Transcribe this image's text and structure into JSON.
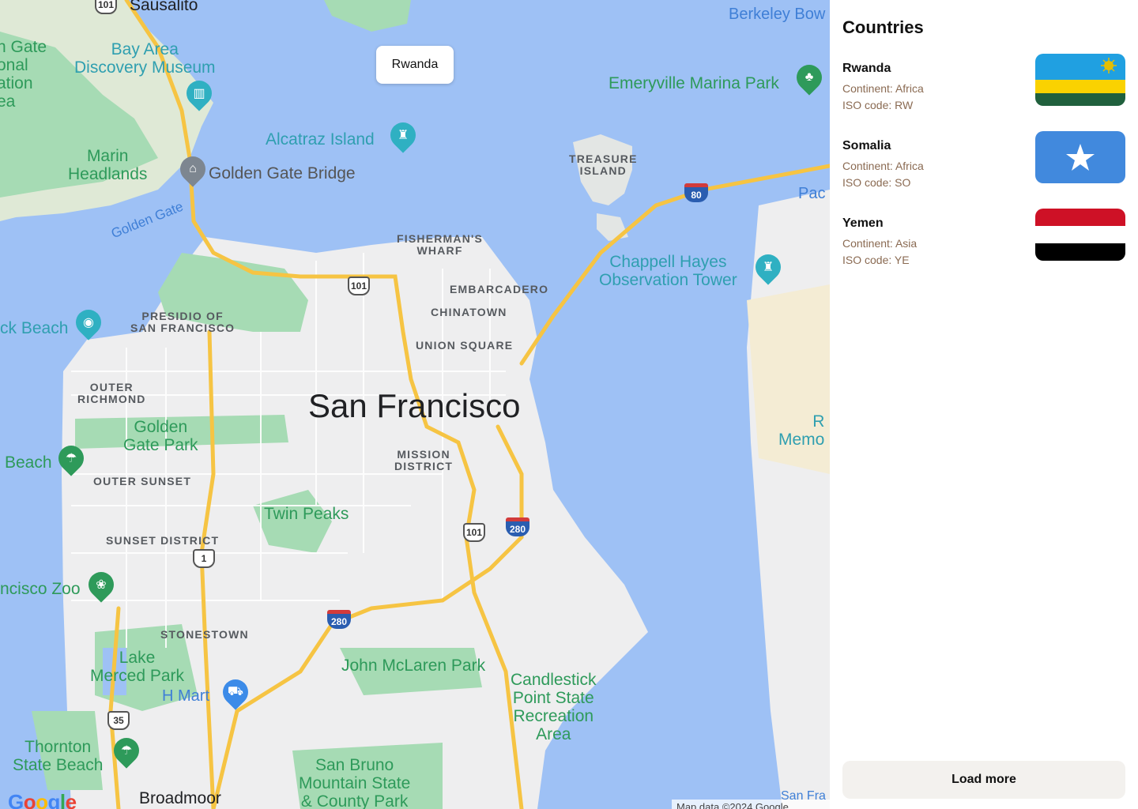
{
  "map": {
    "tooltip": "Rwanda",
    "labels": {
      "sausalito": "Sausalito",
      "berkeley": "Berkeley Bow",
      "golden_gate_nra": "n Gate\nonal\nation\nea",
      "bay_area_museum": "Bay Area\nDiscovery Museum",
      "emeryville": "Emeryville Marina Park",
      "alcatraz": "Alcatraz Island",
      "marin": "Marin\nHeadlands",
      "gg_bridge": "Golden Gate Bridge",
      "golden_gate_water": "Golden Gate",
      "treasure_island": "TREASURE\nISLAND",
      "pac": "Pac",
      "fishermans": "FISHERMAN'S\nWHARF",
      "embarcadero": "EMBARCADERO",
      "chinatown": "CHINATOWN",
      "union_square": "UNION SQUARE",
      "chappell": "Chappell Hayes\nObservation Tower",
      "presidio": "PRESIDIO OF\nSAN FRANCISCO",
      "ck_beach": "ck Beach",
      "outer_richmond": "OUTER\nRICHMOND",
      "san_francisco": "San Francisco",
      "gg_park": "Golden\nGate Park",
      "beach": "Beach",
      "outer_sunset": "OUTER SUNSET",
      "mission": "MISSION\nDISTRICT",
      "twin_peaks": "Twin Peaks",
      "sunset_district": "SUNSET DISTRICT",
      "sf_zoo": "ncisco Zoo",
      "stonestown": "STONESTOWN",
      "lake_merced": "Lake\nMerced Park",
      "h_mart": "H Mart",
      "john_mclaren": "John McLaren Park",
      "candlestick": "Candlestick\nPoint State\nRecreation\nArea",
      "thornton": "Thornton\nState Beach",
      "san_bruno": "San Bruno\nMountain State\n& County Park",
      "broadmoor": "Broadmoor",
      "r_memo": "R\nMemo",
      "san_fra": "San Fra"
    },
    "shields": {
      "us101_n": "101",
      "us101_top": "101",
      "i80": "80",
      "us101_s": "101",
      "i280_e": "280",
      "ca1": "1",
      "i280_s": "280",
      "ca35": "35"
    },
    "logo": "Google",
    "attribution": "Map data ©2024 Google"
  },
  "sidebar": {
    "title": "Countries",
    "countries": [
      {
        "name": "Rwanda",
        "continent": "Continent: Africa",
        "iso": "ISO code: RW"
      },
      {
        "name": "Somalia",
        "continent": "Continent: Africa",
        "iso": "ISO code: SO"
      },
      {
        "name": "Yemen",
        "continent": "Continent: Asia",
        "iso": "ISO code: YE"
      }
    ],
    "load_more": "Load more"
  },
  "colors": {
    "water": "#9ec1f5",
    "land": "#eeeeef",
    "park": "#a6dbb4",
    "highway": "#f6c443",
    "rwanda_blue": "#20a0e1",
    "rwanda_yellow": "#fad201",
    "rwanda_green": "#20603d",
    "somalia_blue": "#4189dd",
    "yemen_red": "#ce1126",
    "yemen_black": "#000000"
  }
}
